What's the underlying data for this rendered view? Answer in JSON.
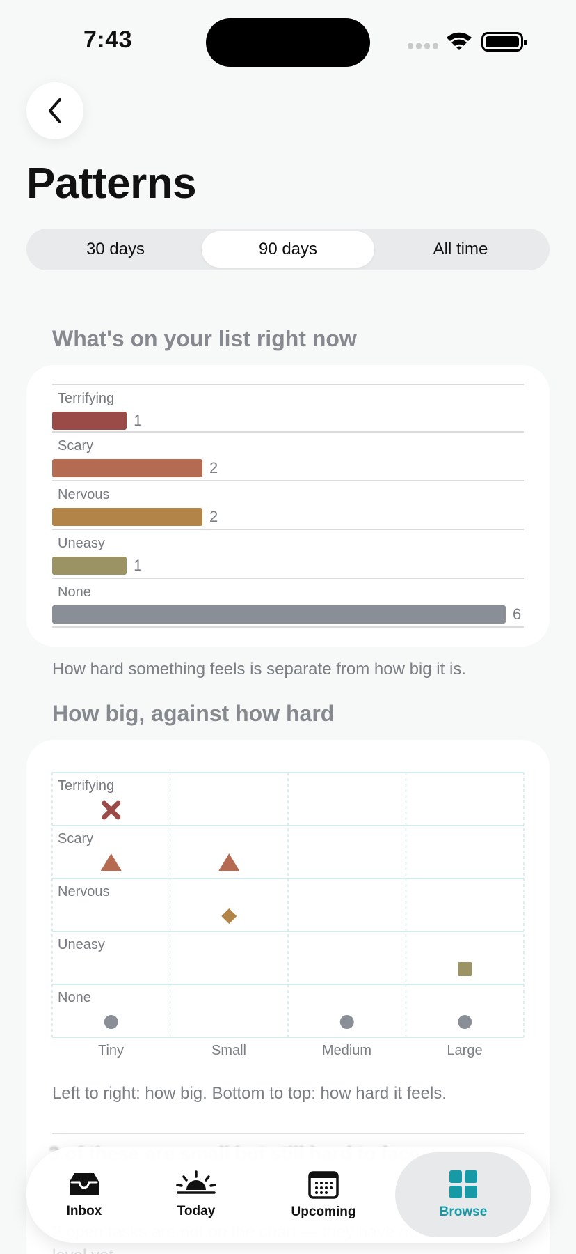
{
  "status_bar": {
    "time": "7:43"
  },
  "header": {
    "title": "Patterns"
  },
  "segmented": {
    "options": [
      "30 days",
      "90 days",
      "All time"
    ],
    "selected": "90 days"
  },
  "list_section": {
    "heading": "What's on your list right now",
    "caption": "How hard something feels is separate from how big it is."
  },
  "scatter_section": {
    "heading": "How big, against how hard",
    "caption": "Left to right: how big. Bottom to top: how hard it feels."
  },
  "footer_texts": {
    "ghost_line": "3 of these are small but still hard to face.",
    "note": "2 open tasks are not on the chart — they have no effort or scary level yet."
  },
  "tabs": [
    {
      "label": "Inbox",
      "icon": "inbox-tray-icon"
    },
    {
      "label": "Today",
      "icon": "sunrise-icon"
    },
    {
      "label": "Upcoming",
      "icon": "calendar-icon"
    },
    {
      "label": "Browse",
      "icon": "grid-icon",
      "active": true
    }
  ],
  "colors": {
    "terrifying": "#9a4a47",
    "scary": "#b56a52",
    "nervous": "#b28448",
    "uneasy": "#9b9363",
    "none": "#8a8e96",
    "accent": "#1899a6"
  },
  "chart_data": [
    {
      "type": "bar",
      "orientation": "horizontal",
      "categories": [
        "Terrifying",
        "Scary",
        "Nervous",
        "Uneasy",
        "None"
      ],
      "values": [
        1,
        2,
        2,
        1,
        6
      ],
      "xlim": [
        0,
        6
      ]
    },
    {
      "type": "scatter",
      "x_categories": [
        "Tiny",
        "Small",
        "Medium",
        "Large"
      ],
      "y_categories": [
        "Terrifying",
        "Scary",
        "Nervous",
        "Uneasy",
        "None"
      ],
      "points": [
        {
          "x": "Tiny",
          "y": "Terrifying",
          "marker": "cross"
        },
        {
          "x": "Tiny",
          "y": "Scary",
          "marker": "triangle"
        },
        {
          "x": "Small",
          "y": "Scary",
          "marker": "triangle"
        },
        {
          "x": "Small",
          "y": "Nervous",
          "marker": "diamond"
        },
        {
          "x": "Large",
          "y": "Uneasy",
          "marker": "square"
        },
        {
          "x": "Tiny",
          "y": "None",
          "marker": "circle"
        },
        {
          "x": "Medium",
          "y": "None",
          "marker": "circle"
        },
        {
          "x": "Large",
          "y": "None",
          "marker": "circle"
        }
      ],
      "grid": true
    }
  ]
}
